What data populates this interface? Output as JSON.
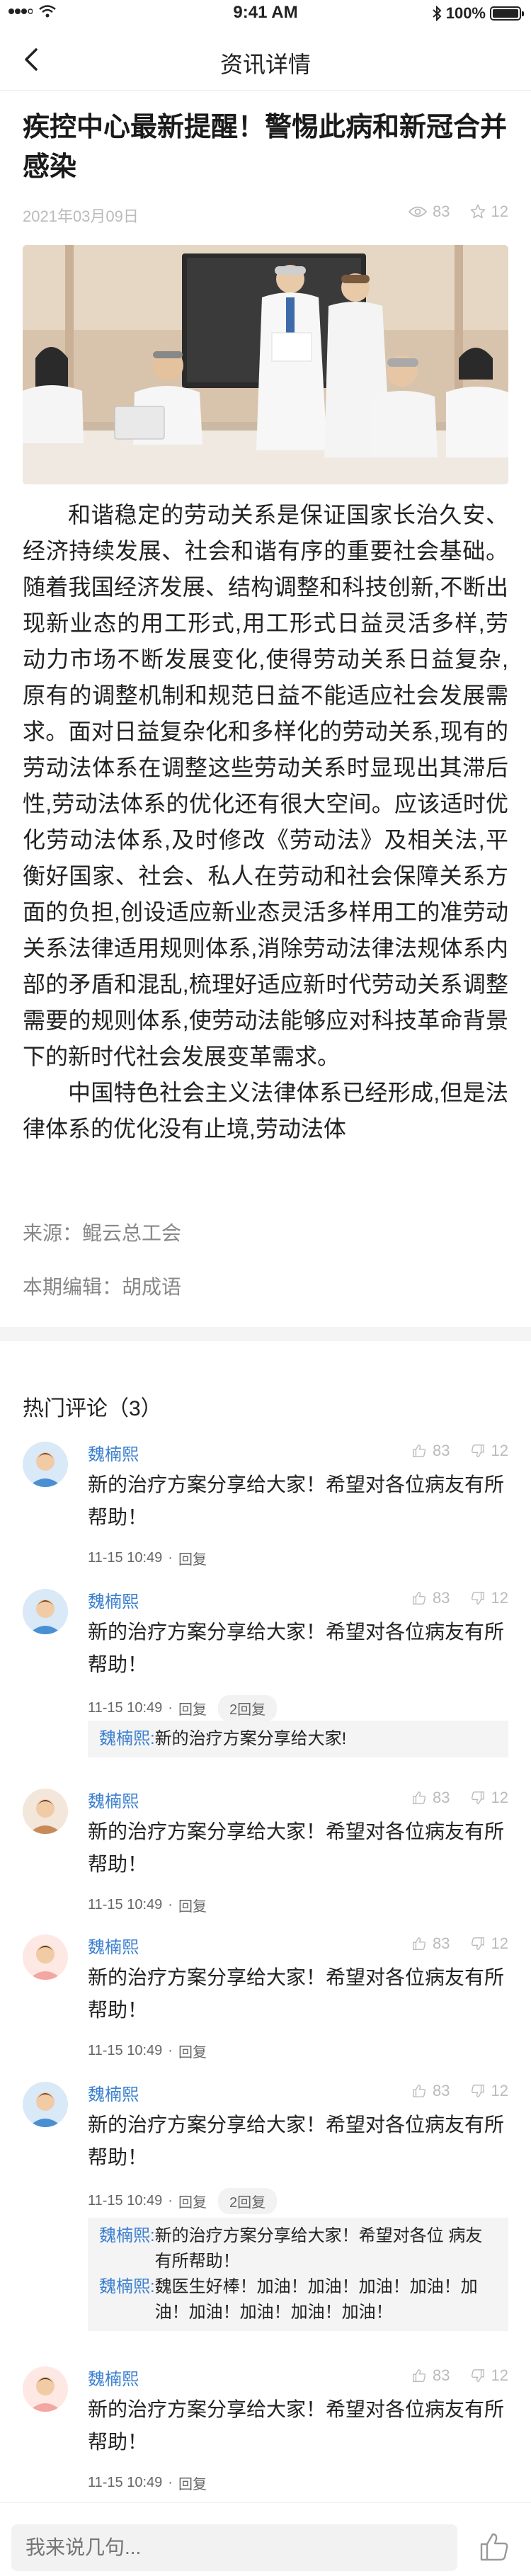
{
  "status_bar": {
    "time": "9:41 AM",
    "battery": "100%",
    "battery_level": 1.0
  },
  "nav": {
    "title": "资讯详情"
  },
  "article": {
    "title": "疾控中心最新提醒！警惕此病和新冠合并感染",
    "date": "2021年03月09日",
    "views": "83",
    "stars": "12",
    "paragraphs": [
      "和谐稳定的劳动关系是保证国家长治久安、经济持续发展、社会和谐有序的重要社会基础。随着我国经济发展、结构调整和科技创新,不断出现新业态的用工形式,用工形式日益灵活多样,劳动力市场不断发展变化,使得劳动关系日益复杂,原有的调整机制和规范日益不能适应社会发展需求。面对日益复杂化和多样化的劳动关系,现有的劳动法体系在调整这些劳动关系时显现出其滞后性,劳动法体系的优化还有很大空间。应该适时优化劳动法体系,及时修改《劳动法》及相关法,平衡好国家、社会、私人在劳动和社会保障关系方面的负担,创设适应新业态灵活多样用工的准劳动关系法律适用规则体系,消除劳动法律法规体系内部的矛盾和混乱,梳理好适应新时代劳动关系调整需要的规则体系,使劳动法能够应对科技革命背景下的新时代社会发展变革需求。",
      "中国特色社会主义法律体系已经形成,但是法律体系的优化没有止境,劳动法体"
    ],
    "source": "来源：鲲云总工会",
    "editor": "本期编辑：胡成语"
  },
  "comments_section": {
    "header": "热门评论（3）",
    "comments": [
      {
        "author": "魏楠熙",
        "likes": "83",
        "dislikes": "12",
        "text": "新的治疗方案分享给大家！希望对各位病友有所帮助！",
        "time": "11-15  10:49",
        "reply_label": "回复",
        "reply_count": "",
        "replies": []
      },
      {
        "author": "魏楠熙",
        "likes": "83",
        "dislikes": "12",
        "text": "新的治疗方案分享给大家！希望对各位病友有所帮助！",
        "time": "11-15  10:49",
        "reply_label": "回复",
        "reply_count": "2回复",
        "replies": [
          {
            "name": "魏楠熙:",
            "text": "新的治疗方案分享给大家!"
          }
        ]
      },
      {
        "author": "魏楠熙",
        "likes": "83",
        "dislikes": "12",
        "text": "新的治疗方案分享给大家！希望对各位病友有所帮助！",
        "time": "11-15  10:49",
        "reply_label": "回复",
        "reply_count": "",
        "replies": []
      },
      {
        "author": "魏楠熙",
        "likes": "83",
        "dislikes": "12",
        "text": "新的治疗方案分享给大家！希望对各位病友有所帮助！",
        "time": "11-15  10:49",
        "reply_label": "回复",
        "reply_count": "",
        "replies": []
      },
      {
        "author": "魏楠熙",
        "likes": "83",
        "dislikes": "12",
        "text": "新的治疗方案分享给大家！希望对各位病友有所帮助！",
        "time": "11-15  10:49",
        "reply_label": "回复",
        "reply_count": "2回复",
        "replies": [
          {
            "name": "魏楠熙:",
            "text": "新的治疗方案分享给大家！希望对各位 病友有所帮助！"
          },
          {
            "name": "魏楠熙:",
            "text": "魏医生好棒！加油！加油！加油！加油！加油！加油！加油！加油！加油！"
          }
        ]
      },
      {
        "author": "魏楠熙",
        "likes": "83",
        "dislikes": "12",
        "text": "新的治疗方案分享给大家！希望对各位病友有所帮助！",
        "time": "11-15  10:49",
        "reply_label": "回复",
        "reply_count": "",
        "replies": []
      }
    ]
  },
  "bottom_bar": {
    "placeholder": "我来说几句..."
  },
  "colors": {
    "accent": "#3a7fd0",
    "muted": "#bbbbbb",
    "text": "#222222",
    "divider": "#f4f4f4"
  }
}
